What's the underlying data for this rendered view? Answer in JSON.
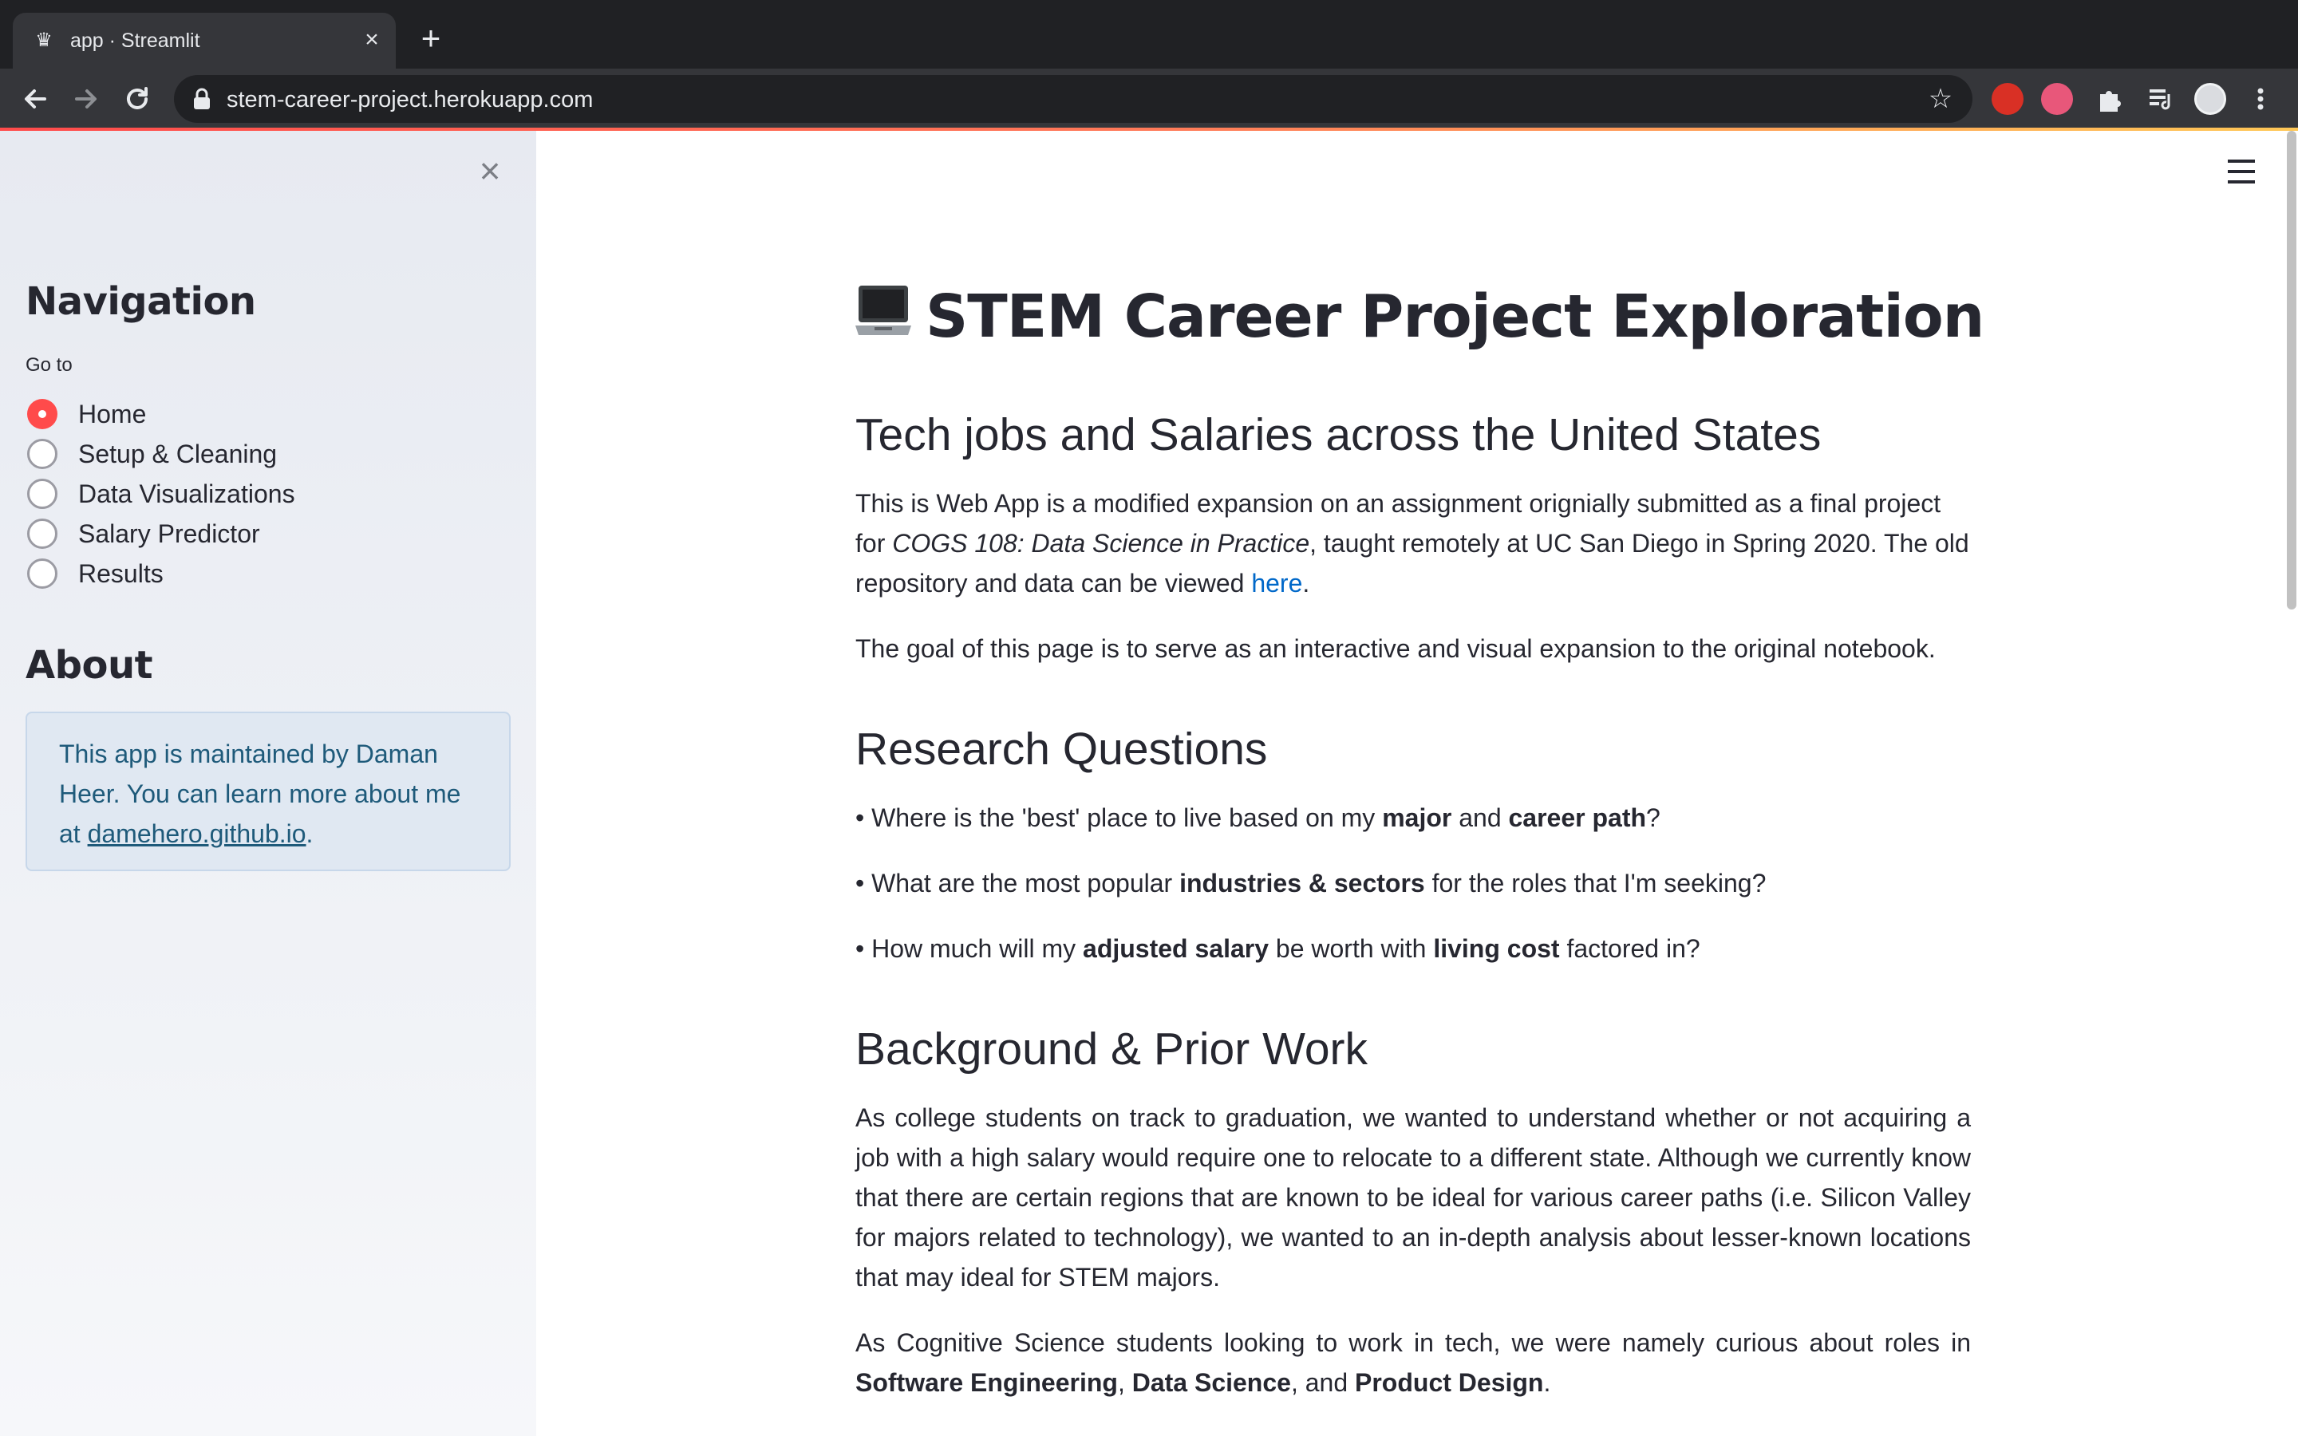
{
  "browser": {
    "tab_title": "app · Streamlit",
    "url": "stem-career-project.herokuapp.com",
    "icons": [
      "streamlit-crown-icon",
      "close-tab-icon",
      "new-tab-icon",
      "back-icon",
      "forward-icon",
      "reload-icon",
      "lock-icon",
      "bookmark-star-icon",
      "adblock-icon",
      "extension-t-icon",
      "puzzle-extensions-icon",
      "media-queue-icon",
      "profile-avatar-icon",
      "more-menu-icon"
    ]
  },
  "sidebar": {
    "navigation_heading": "Navigation",
    "goto_label": "Go to",
    "options": [
      {
        "label": "Home",
        "selected": true
      },
      {
        "label": "Setup & Cleaning",
        "selected": false
      },
      {
        "label": "Data Visualizations",
        "selected": false
      },
      {
        "label": "Salary Predictor",
        "selected": false
      },
      {
        "label": "Results",
        "selected": false
      }
    ],
    "about_heading": "About",
    "about_text_1": "This app is maintained by Daman Heer. You can learn more about me at ",
    "about_link": "damehero.github.io",
    "about_text_2": "."
  },
  "main": {
    "title": "STEM Career Project Exploration",
    "section1_heading": "Tech jobs and Salaries across the United States",
    "intro_1": "This is Web App is a modified expansion on an assignment orignially submitted as a final project for ",
    "intro_course": "COGS 108: Data Science in Practice",
    "intro_2": ", taught remotely at UC San Diego in Spring 2020. The old repository and data can be viewed ",
    "intro_link": "here",
    "intro_3": ".",
    "goal": "The goal of this page is to serve as an interactive and visual expansion to the original notebook.",
    "section2_heading": "Research Questions",
    "q1_a": "• Where is the 'best' place to live based on my ",
    "q1_b1": "major",
    "q1_and": " and ",
    "q1_b2": "career path",
    "q1_end": "?",
    "q2_a": "• What are the most popular ",
    "q2_b": "industries & sectors",
    "q2_end": " for the roles that I'm seeking?",
    "q3_a": "• How much will my ",
    "q3_b1": "adjusted salary",
    "q3_mid": " be worth with ",
    "q3_b2": "living cost",
    "q3_end": " factored in?",
    "section3_heading": "Background & Prior Work",
    "bg1": "As college students on track to graduation, we wanted to understand whether or not acquiring a job with a high salary would require one to relocate to a different state. Although we currently know that there are certain regions that are known to be ideal for various career paths (i.e. Silicon Valley for majors related to technology), we wanted to an in-depth analysis about lesser-known locations that may ideal for STEM majors.",
    "bg2_a": "As Cognitive Science students looking to work in tech, we were namely curious about roles in ",
    "bg2_b1": "Software Engineering",
    "bg2_c1": ", ",
    "bg2_b2": "Data Science",
    "bg2_c2": ", and ",
    "bg2_b3": "Product Design",
    "bg2_end": "."
  },
  "colors": {
    "accent": "#ff4b4b",
    "link": "#0068c9",
    "info_bg": "#e0e8f2",
    "info_text": "#1e5a7a"
  }
}
